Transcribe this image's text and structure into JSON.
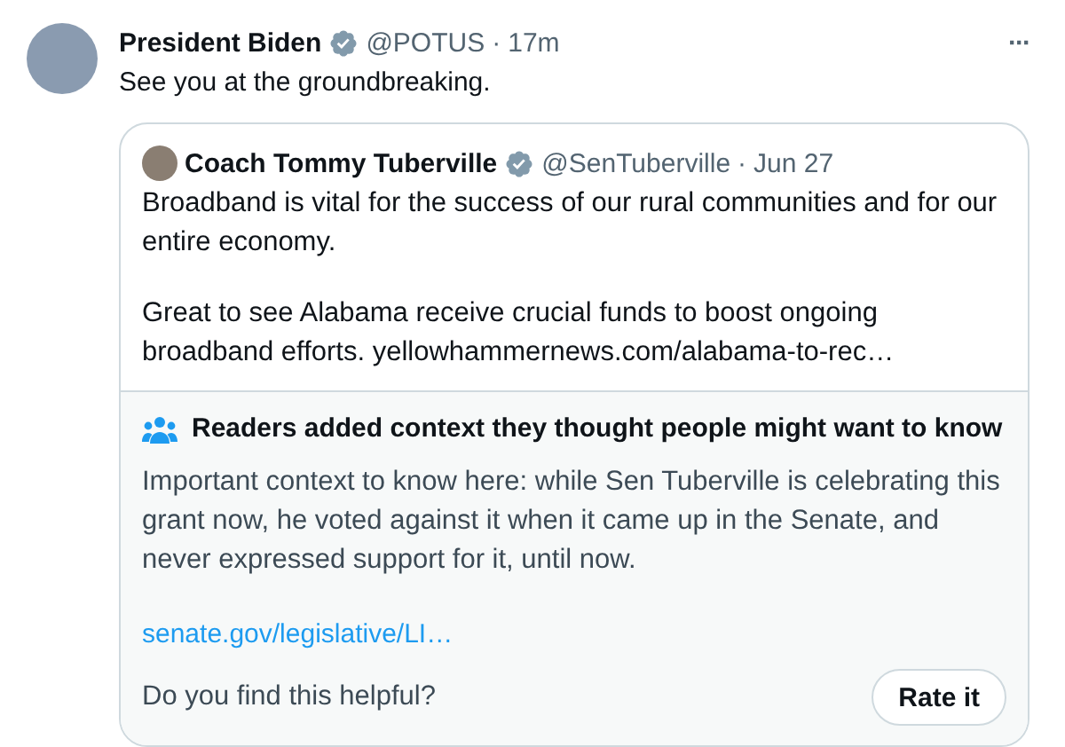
{
  "tweet": {
    "author": "President Biden",
    "verified": true,
    "handle": "@POTUS",
    "separator": "·",
    "time": "17m",
    "more": "···",
    "text": "See you at the groundbreaking.",
    "quote": {
      "author": "Coach Tommy Tuberville",
      "verified": true,
      "handle": "@SenTuberville",
      "separator": "·",
      "time": "Jun 27",
      "paragraphs": [
        {
          "text": "Broadband is vital for the success of our rural communities and for our entire economy."
        },
        {
          "text": "Great to see Alabama receive crucial funds to boost ongoing broadband efforts. ",
          "link": "yellowhammernews.com/alabama-to-rec…"
        }
      ],
      "context": {
        "title": "Readers added context they thought people might want to know",
        "text": "Important context to know here: while Sen Tuberville is celebrating this grant now, he voted against it when it came up in the Senate, and never expressed support for it, until now.",
        "link": "senate.gov/legislative/LI…",
        "question": "Do you find this helpful?",
        "button": "Rate it"
      }
    }
  }
}
